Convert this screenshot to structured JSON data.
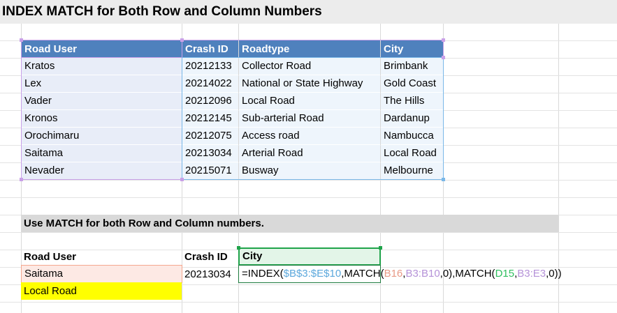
{
  "title": "INDEX MATCH for Both Row and Column Numbers",
  "table": {
    "headers": [
      "Road User",
      "Crash ID",
      "Roadtype",
      "City"
    ],
    "rows": [
      [
        "Kratos",
        "20212133",
        "Collector Road",
        "Brimbank"
      ],
      [
        "Lex",
        "20214022",
        "National or State Highway",
        "Gold Coast"
      ],
      [
        "Vader",
        "20212096",
        "Local Road",
        "The Hills"
      ],
      [
        "Kronos",
        "20212145",
        "Sub-arterial Road",
        "Dardanup"
      ],
      [
        "Orochimaru",
        "20212075",
        "Access road",
        "Nambucca"
      ],
      [
        "Saitama",
        "20213034",
        "Arterial Road",
        "Local Road"
      ],
      [
        "Nevader",
        "20215071",
        "Busway",
        "Melbourne"
      ]
    ]
  },
  "banner": "Use MATCH for both Row and Column numbers.",
  "lookup": {
    "road_user_label": "Road User",
    "crash_id_label": "Crash ID",
    "city_label": "City",
    "road_user_value": "Saitama",
    "crash_id_value": "20213034",
    "result": "Local Road",
    "formula": {
      "p1": "=INDEX(",
      "p2": "$B$3:$E$10",
      "p3": ",MATCH(",
      "p4": "B16",
      "p5": ",",
      "p6": "B3:B10",
      "p7": ",0),MATCH(",
      "p8": "D15",
      "p9": ",",
      "p10": "B3:E3",
      "p11": ",0))"
    }
  },
  "colors": {
    "header_blue": "#4f81bd",
    "result_yellow": "#ffff00",
    "active_green": "#1fa34a"
  }
}
